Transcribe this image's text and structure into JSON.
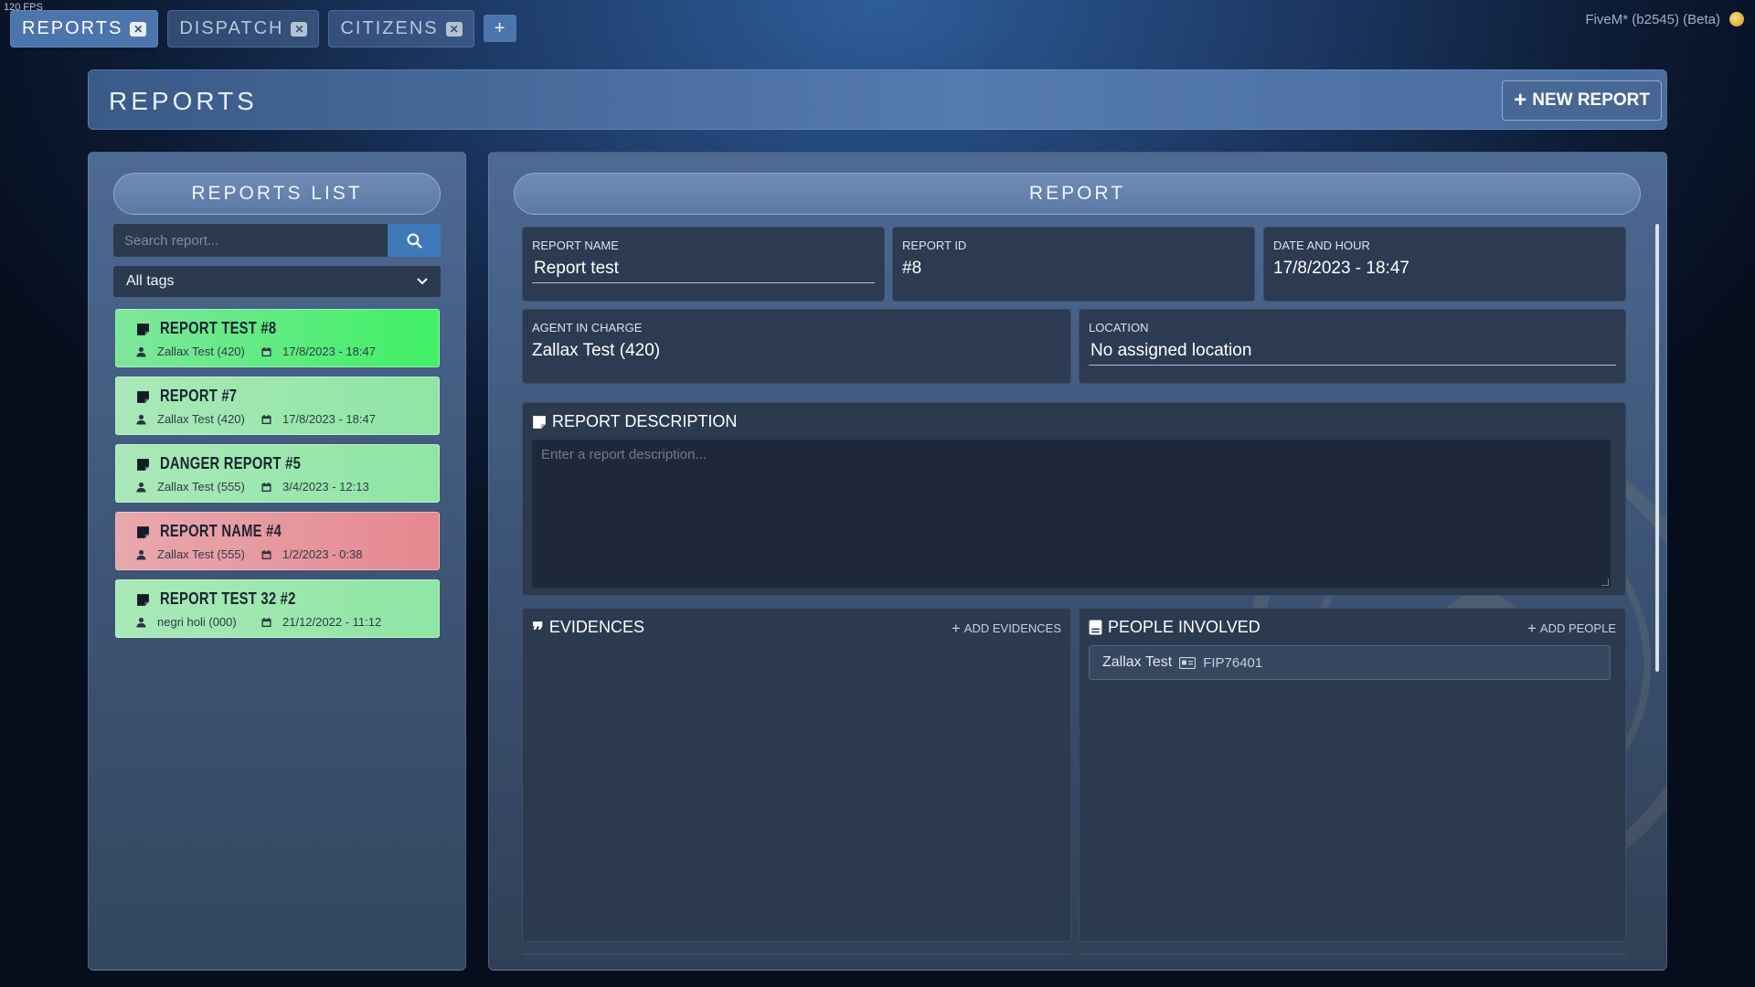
{
  "app": {
    "fps": "120 FPS",
    "version": "FiveM* (b2545) (Beta)"
  },
  "tabs": [
    {
      "label": "REPORTS",
      "active": true
    },
    {
      "label": "DISPATCH",
      "active": false
    },
    {
      "label": "CITIZENS",
      "active": false
    }
  ],
  "tab_add": "+",
  "header": {
    "title": "REPORTS",
    "new_report": "NEW REPORT"
  },
  "reports_list": {
    "title": "REPORTS LIST",
    "search_placeholder": "Search report...",
    "tag_filter": "All tags",
    "items": [
      {
        "title": "REPORT TEST #8",
        "agent": "Zallax Test (420)",
        "date": "17/8/2023 - 18:47",
        "color": "#4ef06f"
      },
      {
        "title": "REPORT #7",
        "agent": "Zallax Test (420)",
        "date": "17/8/2023 - 18:47",
        "color": "#8fe6a4"
      },
      {
        "title": "DANGER REPORT #5",
        "agent": "Zallax Test (555)",
        "date": "3/4/2023 - 12:13",
        "color": "#8fe6a4"
      },
      {
        "title": "REPORT NAME #4",
        "agent": "Zallax Test (555)",
        "date": "1/2/2023 - 0:38",
        "color": "#e5888f"
      },
      {
        "title": "REPORT TEST 32 #2",
        "agent": "negri holi (000)",
        "date": "21/12/2022 - 11:12",
        "color": "#8fe6a4"
      }
    ]
  },
  "report": {
    "title": "REPORT",
    "name_label": "REPORT NAME",
    "name_value": "Report test",
    "id_label": "REPORT ID",
    "id_value": "#8",
    "date_label": "DATE AND HOUR",
    "date_value": "17/8/2023 - 18:47",
    "agent_label": "AGENT IN CHARGE",
    "agent_value": "Zallax Test (420)",
    "location_label": "LOCATION",
    "location_value": "No assigned location",
    "description_label": "REPORT DESCRIPTION",
    "description_placeholder": "Enter a report description...",
    "evidences_label": "EVIDENCES",
    "add_evidences": "ADD EVIDENCES",
    "people_label": "PEOPLE INVOLVED",
    "add_people": "ADD PEOPLE",
    "people": [
      {
        "name": "Zallax Test",
        "code": "FIP76401"
      }
    ]
  },
  "icons": [
    "close-icon",
    "plus-icon",
    "search-icon",
    "chevron-down-icon",
    "note-icon",
    "user-icon",
    "calendar-icon",
    "quote-icon",
    "id-card-icon",
    "police-seal-icon"
  ]
}
